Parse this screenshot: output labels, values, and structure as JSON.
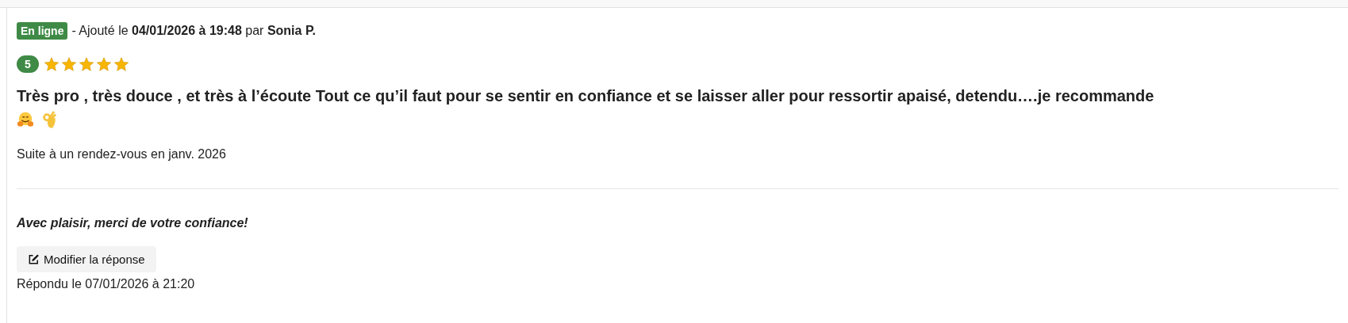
{
  "review": {
    "status": "En ligne",
    "meta": "- Ajouté le **04/01/2026 à 19:48** par **Sonia P.**",
    "rating": "5",
    "stars": 5,
    "text": "Très pro , très douce , et très à l’écoute  Tout ce qu’il faut pour se sentir en confiance et se laisser aller pour ressortir apaisé, detendu….je recommande",
    "context": "Suite à un rendez-vous en janv. 2026"
  },
  "reply": {
    "text": "Avec plaisir, merci de votre confiance!",
    "button": "Modifier la réponse",
    "answered": "Répondu le 07/01/2026 à 21:20"
  }
}
